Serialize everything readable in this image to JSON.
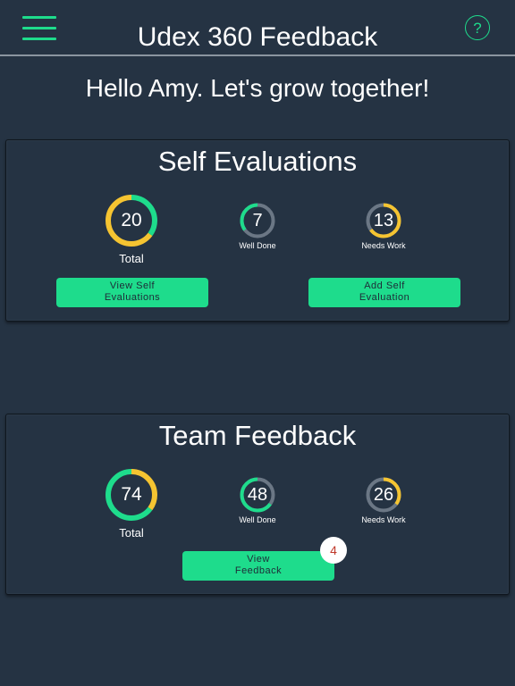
{
  "header": {
    "title": "Udex 360 Feedback",
    "menu_icon": "hamburger-menu-icon",
    "help_icon": "help-icon",
    "help_glyph": "?"
  },
  "greeting": "Hello Amy. Let's grow together!",
  "colors": {
    "background": "#253343",
    "accent_green": "#1edc8c",
    "accent_yellow": "#f5c431",
    "ring_track": "#6b7785"
  },
  "self_evaluations": {
    "title": "Self Evaluations",
    "total": {
      "value": "20",
      "label": "Total"
    },
    "well_done": {
      "value": "7",
      "label": "Well Done"
    },
    "needs_work": {
      "value": "13",
      "label": "Needs Work"
    },
    "view_button": {
      "line1": "View Self",
      "line2": "Evaluations"
    },
    "add_button": {
      "line1": "Add Self",
      "line2": "Evaluation"
    }
  },
  "team_feedback": {
    "title": "Team Feedback",
    "total": {
      "value": "74",
      "label": "Total"
    },
    "well_done": {
      "value": "48",
      "label": "Well Done"
    },
    "needs_work": {
      "value": "26",
      "label": "Needs Work"
    },
    "view_button": {
      "line1": "View",
      "line2": "Feedback"
    },
    "badge_count": "4"
  }
}
